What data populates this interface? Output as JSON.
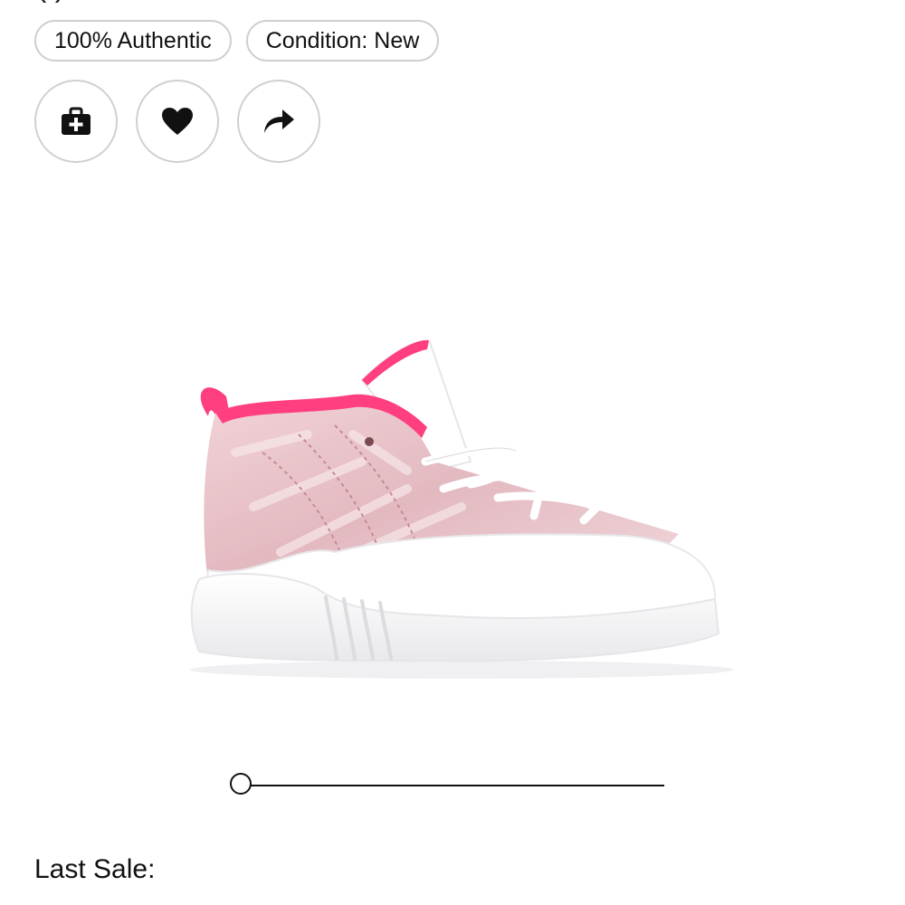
{
  "header": {
    "cut_title_fragment": "(   )"
  },
  "badges": {
    "authentic": "100% Authentic",
    "condition": "Condition: New"
  },
  "actions": {
    "portfolio_icon": "briefcase-plus-icon",
    "favorite_icon": "heart-icon",
    "share_icon": "share-arrow-icon"
  },
  "product": {
    "image_icon": "sneaker-image",
    "colors": {
      "accent_pink": "#ff3f7f",
      "suede_pink": "#e8c3c9",
      "white": "#ffffff"
    }
  },
  "slider": {
    "position_fraction": 0.0
  },
  "sale": {
    "last_sale_label": "Last Sale:"
  }
}
